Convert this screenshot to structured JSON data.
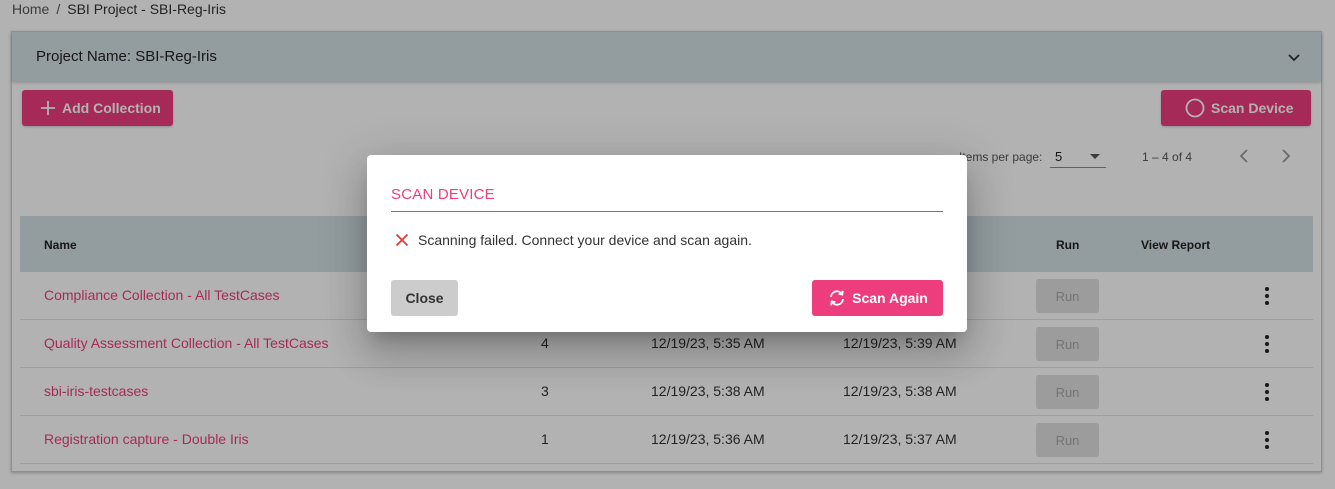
{
  "breadcrumb": {
    "home": "Home",
    "separator": "/",
    "current": "SBI Project - SBI-Reg-Iris"
  },
  "project": {
    "label": "Project Name: SBI-Reg-Iris"
  },
  "toolbar": {
    "add_collection": "Add Collection",
    "scan_device": "Scan Device"
  },
  "paginator": {
    "items_per_page_label": "Items per page:",
    "items_per_page": "5",
    "range": "1 – 4 of 4"
  },
  "table": {
    "headers": {
      "name": "Name",
      "run": "Run",
      "view_report": "View Report"
    },
    "rows": [
      {
        "name": "Compliance Collection - All TestCases",
        "count": "",
        "created": "",
        "last_run": "",
        "run": "Run"
      },
      {
        "name": "Quality Assessment Collection - All TestCases",
        "count": "4",
        "created": "12/19/23, 5:35 AM",
        "last_run": "12/19/23, 5:39 AM",
        "run": "Run"
      },
      {
        "name": "sbi-iris-testcases",
        "count": "3",
        "created": "12/19/23, 5:38 AM",
        "last_run": "12/19/23, 5:38 AM",
        "run": "Run"
      },
      {
        "name": "Registration capture - Double Iris",
        "count": "1",
        "created": "12/19/23, 5:36 AM",
        "last_run": "12/19/23, 5:37 AM",
        "run": "Run"
      }
    ]
  },
  "dialog": {
    "title": "SCAN DEVICE",
    "message": "Scanning failed. Connect your device and scan again.",
    "close": "Close",
    "scan_again": "Scan Again"
  },
  "colors": {
    "accent": "#ee3d7d",
    "header_bg": "#d3e1e6",
    "error": "#e53935"
  },
  "icons": [
    "plus-icon",
    "circle-icon",
    "chevron-down-icon",
    "chevron-left-icon",
    "chevron-right-icon",
    "more-vert-icon",
    "close-x-icon",
    "sync-icon"
  ]
}
